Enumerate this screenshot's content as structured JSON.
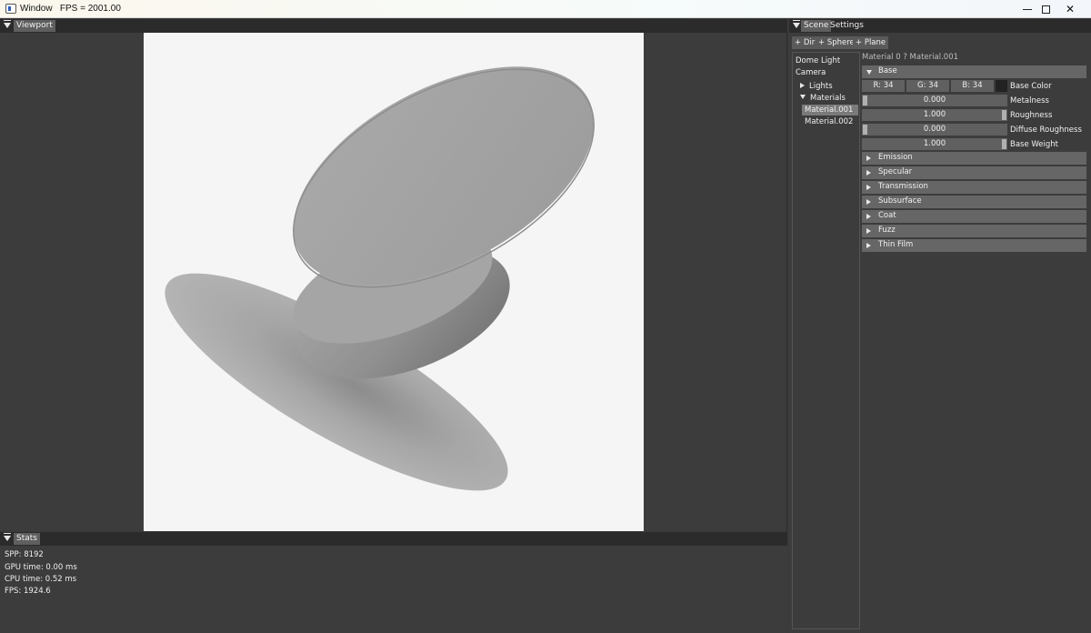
{
  "window": {
    "title": "Window   FPS = 2001.00"
  },
  "viewport": {
    "tab": "Viewport"
  },
  "stats": {
    "tab": "Stats",
    "lines": [
      "SPP: 8192",
      "GPU time: 0.00 ms",
      "CPU time: 0.52 ms",
      "FPS: 1924.6"
    ]
  },
  "scene_panel": {
    "tabs": [
      "Scene",
      "Settings"
    ],
    "buttons": [
      "+ Dir",
      "+ Sphere",
      "+ Plane"
    ],
    "tree": {
      "dome_light": "Dome Light",
      "camera": "Camera",
      "lights": "Lights",
      "materials": "Materials",
      "material_items": [
        "Material.001",
        "Material.002"
      ]
    },
    "material": {
      "title": "Material 0 ? Material.001",
      "base_section": "Base",
      "base_color": {
        "r": "R: 34",
        "g": "G: 34",
        "b": "B: 34",
        "label": "Base Color"
      },
      "sliders": [
        {
          "value": "0.000",
          "label": "Metalness",
          "fraction": 0
        },
        {
          "value": "1.000",
          "label": "Roughness",
          "fraction": 1
        },
        {
          "value": "0.000",
          "label": "Diffuse Roughness",
          "fraction": 0
        },
        {
          "value": "1.000",
          "label": "Base Weight",
          "fraction": 1
        }
      ],
      "collapsed_sections": [
        "Emission",
        "Specular",
        "Transmission",
        "Subsurface",
        "Coat",
        "Fuzz",
        "Thin Film"
      ]
    }
  },
  "colors": {
    "panel_bg": "#3c3c3c",
    "header_bg": "#2b2b2b",
    "render_bg": "#f5f5f5",
    "section_bg": "#666666",
    "selection": "#7a7a7a"
  }
}
